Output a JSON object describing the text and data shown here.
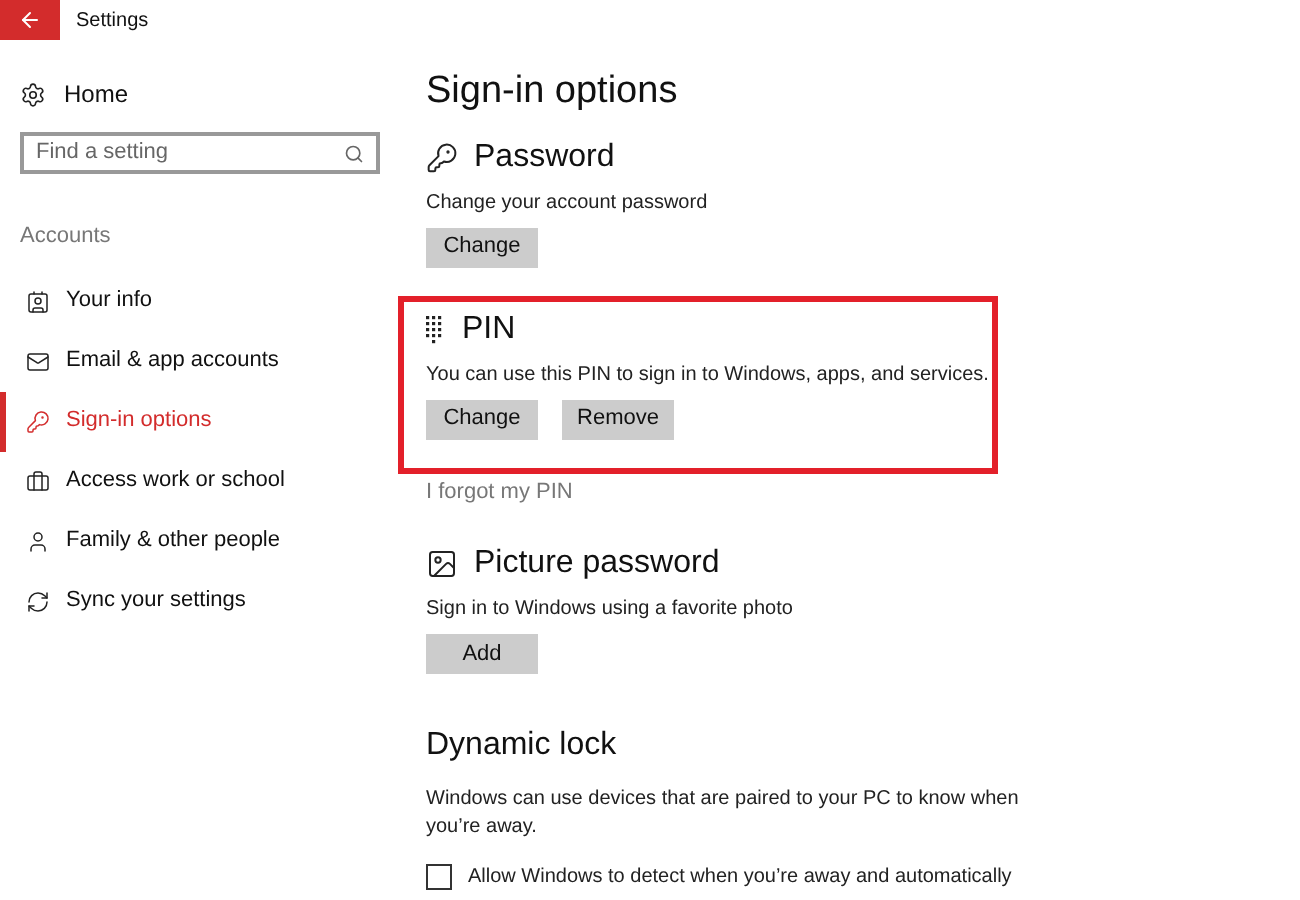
{
  "window": {
    "title": "Settings"
  },
  "sidebar": {
    "home": "Home",
    "search": {
      "placeholder": "Find a setting"
    },
    "section": "Accounts",
    "items": [
      {
        "label": "Your info",
        "selected": false
      },
      {
        "label": "Email & app accounts",
        "selected": false
      },
      {
        "label": "Sign-in options",
        "selected": true
      },
      {
        "label": "Access work or school",
        "selected": false
      },
      {
        "label": "Family & other people",
        "selected": false
      },
      {
        "label": "Sync your settings",
        "selected": false
      }
    ]
  },
  "main": {
    "title": "Sign-in options",
    "sections": [
      {
        "kind": "credential",
        "heading": "Password",
        "description": "Change your account password",
        "buttons": [
          "Change"
        ]
      },
      {
        "kind": "credential",
        "heading": "PIN",
        "description": "You can use this PIN to sign in to Windows, apps, and services.",
        "buttons": [
          "Change",
          "Remove"
        ],
        "highlighted": true,
        "link": "I forgot my PIN"
      },
      {
        "kind": "credential",
        "heading": "Picture password",
        "description": "Sign in to Windows using a favorite photo",
        "buttons": [
          "Add"
        ]
      },
      {
        "kind": "checkbox-setting",
        "heading": "Dynamic lock",
        "description": "Windows can use devices that are paired to your PC to know when you’re away.",
        "checkbox": {
          "label": "Allow Windows to detect when you’re away and automatically",
          "checked": false
        }
      }
    ]
  }
}
